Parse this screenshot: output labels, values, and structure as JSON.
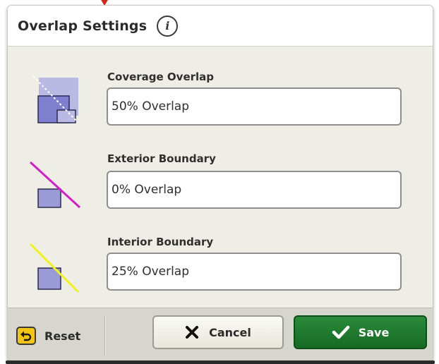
{
  "dialog": {
    "title": "Overlap Settings",
    "info_icon": "info-icon"
  },
  "settings": [
    {
      "label": "Coverage Overlap",
      "value": "50% Overlap",
      "icon": "coverage-overlap-icon"
    },
    {
      "label": "Exterior Boundary",
      "value": "0% Overlap",
      "icon": "exterior-boundary-icon"
    },
    {
      "label": "Interior Boundary",
      "value": "25% Overlap",
      "icon": "interior-boundary-icon"
    }
  ],
  "footer": {
    "reset_label": "Reset",
    "cancel_label": "Cancel",
    "save_label": "Save"
  },
  "colors": {
    "save": "#1f7a2f",
    "reset_icon": "#f3c613",
    "exterior_line": "#d41ec8",
    "interior_line": "#f2f21a",
    "shape_fill": "#9a9ad6"
  }
}
